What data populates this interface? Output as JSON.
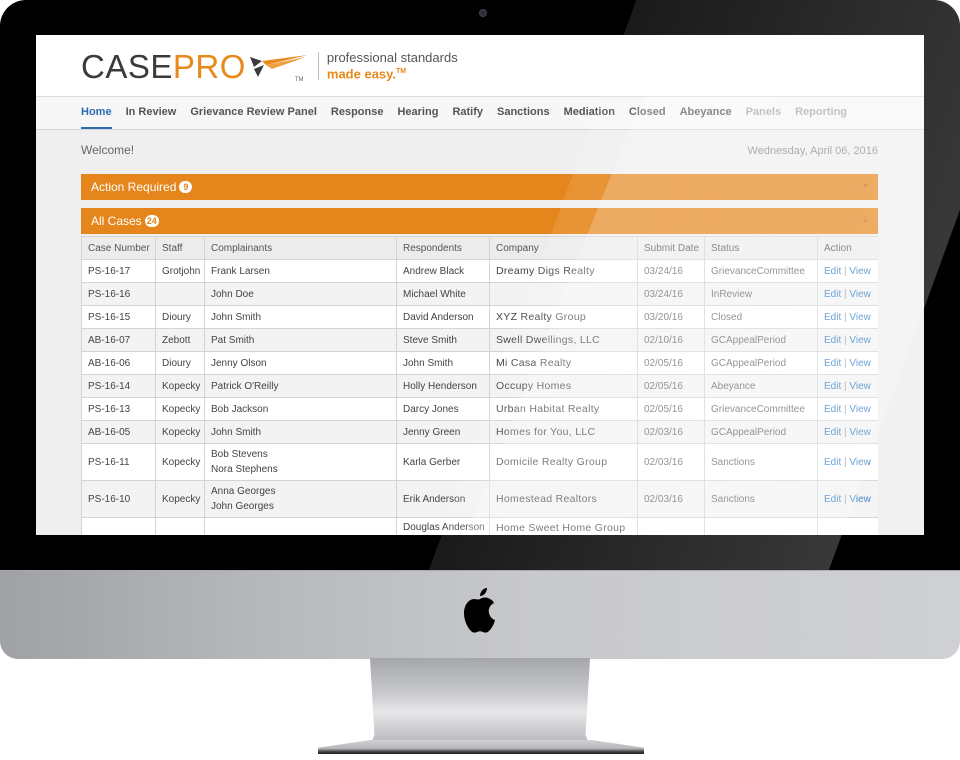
{
  "brand": {
    "name_part1": "CASE",
    "name_part2": "PRO",
    "trademark": "TM",
    "tagline_line1": "professional standards",
    "tagline_line2": "made easy.",
    "tagline_tm": "TM",
    "accent_color": "#e5861c"
  },
  "nav": {
    "items": [
      {
        "label": "Home",
        "state": "active"
      },
      {
        "label": "In Review",
        "state": "normal"
      },
      {
        "label": "Grievance Review Panel",
        "state": "normal"
      },
      {
        "label": "Response",
        "state": "normal"
      },
      {
        "label": "Hearing",
        "state": "normal"
      },
      {
        "label": "Ratify",
        "state": "normal"
      },
      {
        "label": "Sanctions",
        "state": "normal"
      },
      {
        "label": "Mediation",
        "state": "normal"
      },
      {
        "label": "Closed",
        "state": "normal"
      },
      {
        "label": "Abeyance",
        "state": "normal"
      },
      {
        "label": "Panels",
        "state": "disabled"
      },
      {
        "label": "Reporting",
        "state": "disabled"
      }
    ]
  },
  "page": {
    "welcome": "Welcome!",
    "date": "Wednesday, April 06, 2016"
  },
  "panels": {
    "action_required": {
      "label": "Action Required",
      "count": "9",
      "toggle_icon": "▼"
    },
    "all_cases": {
      "label": "All Cases",
      "count": "24",
      "toggle_icon": "▲"
    }
  },
  "table": {
    "columns": [
      "Case Number",
      "Staff",
      "Complainants",
      "Respondents",
      "Company",
      "Submit Date",
      "Status",
      "Action"
    ],
    "action_edit": "Edit",
    "action_sep": "|",
    "action_view": "View",
    "rows": [
      {
        "case": "PS-16-17",
        "staff": "Grotjohn",
        "complainants": [
          "Frank Larsen"
        ],
        "respondents": "Andrew Black",
        "company": "Dreamy Digs Realty",
        "date": "03/24/16",
        "status": "GrievanceCommittee"
      },
      {
        "case": "PS-16-16",
        "staff": "",
        "complainants": [
          "John Doe"
        ],
        "respondents": "Michael White",
        "company": "",
        "date": "03/24/16",
        "status": "InReview"
      },
      {
        "case": "PS-16-15",
        "staff": "Dioury",
        "complainants": [
          "John Smith"
        ],
        "respondents": "David Anderson",
        "company": "XYZ Realty Group",
        "date": "03/20/16",
        "status": "Closed"
      },
      {
        "case": "AB-16-07",
        "staff": "Zebott",
        "complainants": [
          "Pat Smith"
        ],
        "respondents": "Steve Smith",
        "company": "Swell Dwellings, LLC",
        "date": "02/10/16",
        "status": "GCAppealPeriod"
      },
      {
        "case": "AB-16-06",
        "staff": "Dioury",
        "complainants": [
          "Jenny Olson"
        ],
        "respondents": "John Smith",
        "company": "Mi Casa Realty",
        "date": "02/05/16",
        "status": "GCAppealPeriod"
      },
      {
        "case": "PS-16-14",
        "staff": "Kopecky",
        "complainants": [
          "Patrick O'Reilly"
        ],
        "respondents": "Holly Henderson",
        "company": "Occupy Homes",
        "date": "02/05/16",
        "status": "Abeyance"
      },
      {
        "case": "PS-16-13",
        "staff": "Kopecky",
        "complainants": [
          "Bob Jackson"
        ],
        "respondents": "Darcy Jones",
        "company": "Urban Habitat Realty",
        "date": "02/05/16",
        "status": "GrievanceCommittee"
      },
      {
        "case": "AB-16-05",
        "staff": "Kopecky",
        "complainants": [
          "John Smith"
        ],
        "respondents": "Jenny Green",
        "company": "Homes for You, LLC",
        "date": "02/03/16",
        "status": "GCAppealPeriod"
      },
      {
        "case": "PS-16-11",
        "staff": "Kopecky",
        "complainants": [
          "Bob Stevens",
          "Nora Stephens"
        ],
        "respondents": "Karla Gerber",
        "company": "Domicile Realty Group",
        "date": "02/03/16",
        "status": "Sanctions"
      },
      {
        "case": "PS-16-10",
        "staff": "Kopecky",
        "complainants": [
          "Anna Georges",
          "John Georges"
        ],
        "respondents": "Erik Anderson",
        "company": "Homestead Realtors",
        "date": "02/03/16",
        "status": "Sanctions"
      },
      {
        "case": "",
        "staff": "",
        "complainants": [
          ""
        ],
        "respondents": "Douglas Anderson",
        "company": "Home Sweet Home Group",
        "date": "",
        "status": "",
        "partial": true
      }
    ]
  }
}
